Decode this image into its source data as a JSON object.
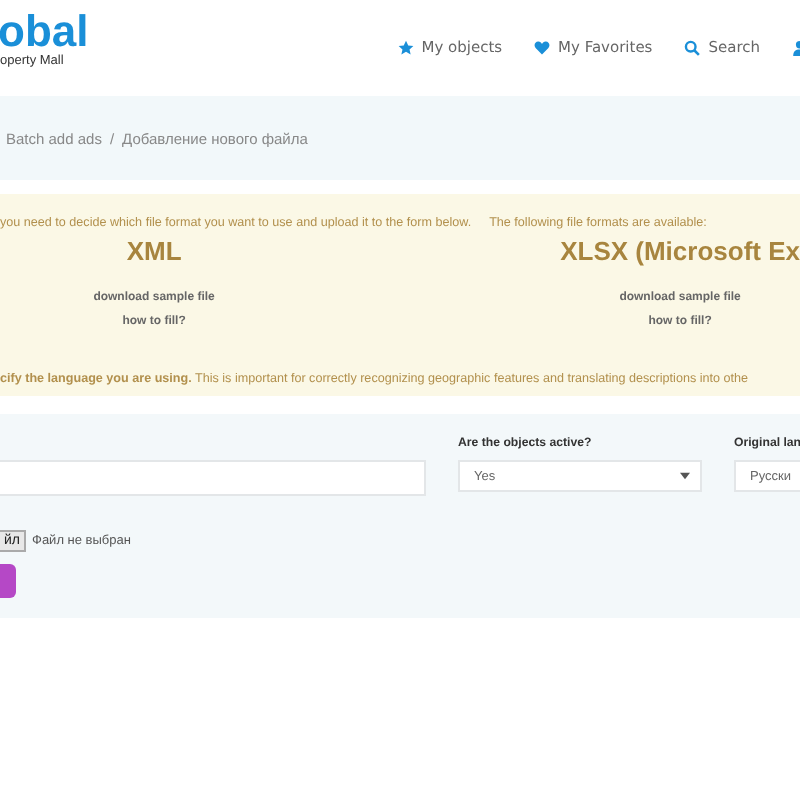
{
  "logo": {
    "name": "obal",
    "tagline": "operty Mall"
  },
  "nav": [
    {
      "kind": "star",
      "label": "My objects"
    },
    {
      "kind": "heart",
      "label": "My Favorites"
    },
    {
      "kind": "search",
      "label": "Search"
    },
    {
      "kind": "user"
    }
  ],
  "breadcrumb": [
    "Batch add ads",
    "Добавление нового файла"
  ],
  "breadcrumb_separator": "/",
  "notice": {
    "intro": "you need to decide which file format you want to use and upload it to the form below.",
    "formats_intro": "The following file formats are available:",
    "formats": [
      {
        "name": "XML",
        "links": [
          "download sample file",
          "how to fill?"
        ]
      },
      {
        "name": "XLSX (Microsoft Ex",
        "links": [
          "download sample file",
          "how to fill?"
        ]
      }
    ],
    "language_note": "**cify the language you are using.** This is important for correctly recognizing geographic features and translating descriptions into othe"
  },
  "form": {
    "active_label": "Are the objects active?",
    "active_value": "Yes",
    "language_label": "Original lan",
    "language_value": "Русски",
    "file_button": "йл",
    "file_status": "Файл не выбран"
  }
}
